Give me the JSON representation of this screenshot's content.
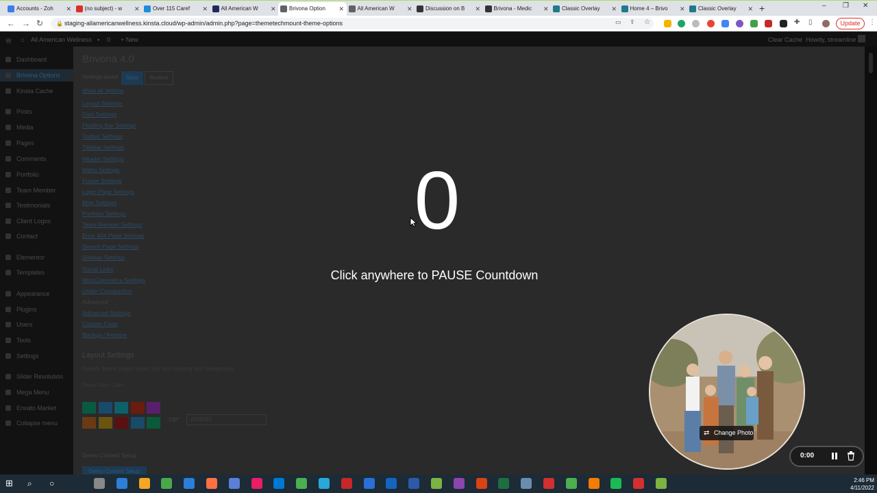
{
  "browser": {
    "tabs": [
      {
        "label": "Accounts - Zoh",
        "color": "#3b7de9",
        "active": false
      },
      {
        "label": "(no subject) - w",
        "color": "#d93025",
        "active": false
      },
      {
        "label": "Over 115 Caref",
        "color": "#1a8fd6",
        "active": false
      },
      {
        "label": "All American W",
        "color": "#1e2a5e",
        "active": false
      },
      {
        "label": "Brivona Option",
        "color": "#5f6368",
        "active": true
      },
      {
        "label": "All American W",
        "color": "#5f6368",
        "active": false
      },
      {
        "label": "Discussion on B",
        "color": "#333333",
        "active": false
      },
      {
        "label": "Brivona - Medic",
        "color": "#333333",
        "active": false
      },
      {
        "label": "Classic Overlay",
        "color": "#1f7a8c",
        "active": false
      },
      {
        "label": "Home 4 – Brivo",
        "color": "#1f7a8c",
        "active": false
      },
      {
        "label": "Classic Overlay",
        "color": "#1f7a8c",
        "active": false
      }
    ],
    "url": "staging-allamericanwellness.kinsta.cloud/wp-admin/admin.php?page=themetechmount-theme-options",
    "update_label": "Update"
  },
  "adminbar": {
    "site_name": "All American Wellness",
    "comments_count": "0",
    "new_label": "+ New",
    "clear_cache": "Clear Cache",
    "howdy": "Howdy, streamline"
  },
  "sidebar": {
    "items": [
      {
        "label": "Dashboard",
        "active": false
      },
      {
        "label": "Brivona Options",
        "active": true
      },
      {
        "label": "Kinsta Cache",
        "active": false
      },
      {
        "label": "Posts",
        "active": false
      },
      {
        "label": "Media",
        "active": false
      },
      {
        "label": "Pages",
        "active": false
      },
      {
        "label": "Comments",
        "active": false
      },
      {
        "label": "Portfolio",
        "active": false
      },
      {
        "label": "Team Member",
        "active": false
      },
      {
        "label": "Testimonials",
        "active": false
      },
      {
        "label": "Client Logos",
        "active": false
      },
      {
        "label": "Contact",
        "active": false
      },
      {
        "label": "Elementor",
        "active": false
      },
      {
        "label": "Templates",
        "active": false
      },
      {
        "label": "Appearance",
        "active": false
      },
      {
        "label": "Plugins",
        "active": false
      },
      {
        "label": "Users",
        "active": false
      },
      {
        "label": "Tools",
        "active": false
      },
      {
        "label": "Settings",
        "active": false
      },
      {
        "label": "Slider Revolution",
        "active": false
      },
      {
        "label": "Mega Menu",
        "active": false
      },
      {
        "label": "Envato Market",
        "active": false
      },
      {
        "label": "Collapse menu",
        "active": false
      }
    ]
  },
  "content": {
    "title": "Brivona 4.0",
    "settings_saved": "Settings saved",
    "save_label": "Save",
    "restore_label": "Restore",
    "show_all": "show all options",
    "option_links": [
      "Layout Settings",
      "Font Settings",
      "Floating Bar Settings",
      "Topbar Settings",
      "Titlebar Settings",
      "Header Settings",
      "Menu Settings",
      "Footer Settings",
      "Login Page Settings",
      "Blog Settings",
      "Portfolio Settings",
      "Team Member Settings",
      "Error 404 Page Settings",
      "Search Page Settings",
      "Sidebar Settings",
      "Social Links",
      "WooCommerce Settings",
      "Under Construction",
      "Advanced",
      "Advanced Settings",
      "Custom Code",
      "Backup / Restore"
    ],
    "section_title": "Layout Settings",
    "section_desc": "Specify theme pages layout, the skin coloring and background.",
    "skin_label": "Select Skin Color",
    "swatches": [
      "#0a5a42",
      "#1a4a6a",
      "#0f5f6a",
      "#6a1c0e",
      "#5a1f6a",
      "#6a3a14",
      "#6a5410",
      "#5a1010",
      "#1a4a6a",
      "#0a5a3a"
    ],
    "or_label": "\"OR\"",
    "color_value": "#01b985",
    "demo_title": "Demo Content Setup",
    "demo_button": "Demo Content Setup"
  },
  "overlay": {
    "countdown": "0",
    "message": "Click anywhere to PAUSE Countdown"
  },
  "recorder": {
    "change_photo": "Change Photo",
    "timer": "0:00"
  },
  "taskbar": {
    "time": "2:46 PM",
    "date": "4/11/2022",
    "icons": [
      "#888888",
      "#2b7fd8",
      "#f5a623",
      "#4aa84a",
      "#2b7fd8",
      "#ff7043",
      "#5b7fd6",
      "#e91e63",
      "#0078d4",
      "#4caf50",
      "#2aa8d8",
      "#c62828",
      "#2b6fd8",
      "#1565c0",
      "#2b5aa8",
      "#7cb342",
      "#8e44ad",
      "#d84315",
      "#1d6f42",
      "#6a8caf",
      "#d32f2f",
      "#4caf50",
      "#f57c00",
      "#1db954",
      "#d32f2f",
      "#7cb342"
    ]
  }
}
